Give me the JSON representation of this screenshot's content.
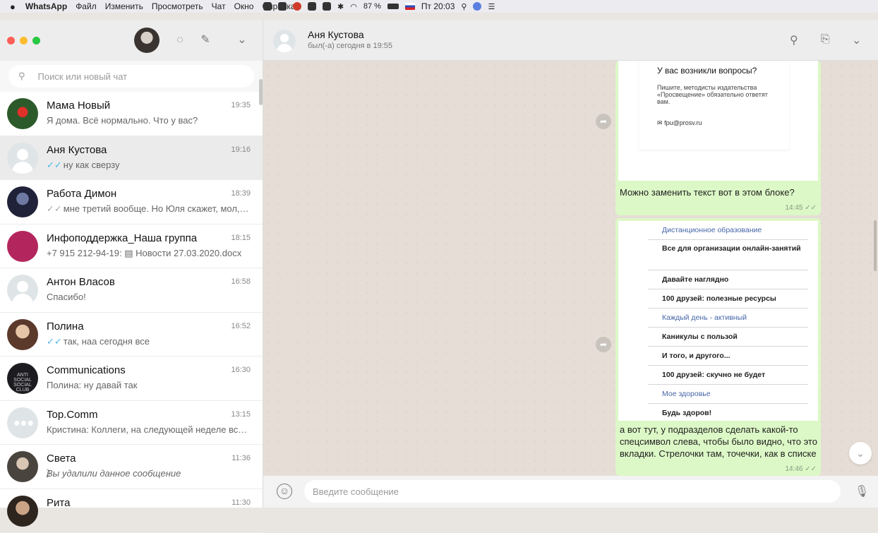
{
  "menubar": {
    "apple": "",
    "app": "WhatsApp",
    "items": [
      "Файл",
      "Изменить",
      "Просмотреть",
      "Чат",
      "Окно",
      "Справка"
    ],
    "battery": "87 %",
    "clock": "Пт 20:03"
  },
  "left": {
    "search_placeholder": "Поиск или новый чат",
    "chats": [
      {
        "name": "Мама Новый",
        "time": "19:35",
        "preview": "Я дома. Всё нормально. Что у вас?"
      },
      {
        "name": "Аня Кустова",
        "time": "19:16",
        "tick": "✓✓",
        "preview": "ну как сверзу"
      },
      {
        "name": "Работа Димон",
        "time": "18:39",
        "tick": "✓✓",
        "preview": "мне третий вообще. Но Юля скажет, мол, н..."
      },
      {
        "name": "Инфоподдержка_Наша группа",
        "time": "18:15",
        "preview": "+7 915 212-94-19: ▤ Новости 27.03.2020.docx"
      },
      {
        "name": "Антон Власов",
        "time": "16:58",
        "preview": "Спасибо!"
      },
      {
        "name": "Полина",
        "time": "16:52",
        "tick": "✓✓",
        "preview": "так, наа сегодня все"
      },
      {
        "name": "Communications",
        "time": "16:30",
        "preview": "Полина: ну давай так"
      },
      {
        "name": "Top.Comm",
        "time": "13:15",
        "preview": "Кристина: Коллеги, на следующей неделе все ..."
      },
      {
        "name": "Света",
        "time": "11:36",
        "preview": "⃠Вы удалили данное сообщение"
      },
      {
        "name": "Рита",
        "time": "11:30",
        "preview": ""
      }
    ],
    "avatar_text_communications": "ANTI SOCIAL SOCIAL CLUB"
  },
  "right": {
    "contact_name": "Аня Кустова",
    "contact_status": "был(-а) сегодня в 19:55",
    "card": {
      "title": "У вас возникли вопросы?",
      "text": "Пишите, методисты издательства «Просвещение» обязательно ответят вам.",
      "email": "fpu@prosv.ru"
    },
    "msg1": {
      "text": "Можно заменить текст вот в этом блоке?",
      "time": "14:45 ✓✓"
    },
    "menu_items": [
      {
        "label": "Дистанционное образование",
        "link": true
      },
      {
        "label": "Все для организации онлайн-занятий",
        "link": false
      },
      {
        "label": "Давайте наглядно",
        "link": false
      },
      {
        "label": "100 друзей: полезные ресурсы",
        "link": false
      },
      {
        "label": "Каждый день - активный",
        "link": true
      },
      {
        "label": "Каникулы с пользой",
        "link": false
      },
      {
        "label": "И того, и другого...",
        "link": false
      },
      {
        "label": "100 друзей: скучно не будет",
        "link": false
      },
      {
        "label": "Мое здоровье",
        "link": true
      },
      {
        "label": "Будь здоров!",
        "link": false
      }
    ],
    "msg2": {
      "text": "а вот тут, у подразделов сделать какой-то спецсимвол слева, чтобы было видно, что это вкладки. Стрелочки там, точечки, как в списке",
      "time": "14:46 ✓✓"
    },
    "composer_placeholder": "Введите сообщение"
  }
}
